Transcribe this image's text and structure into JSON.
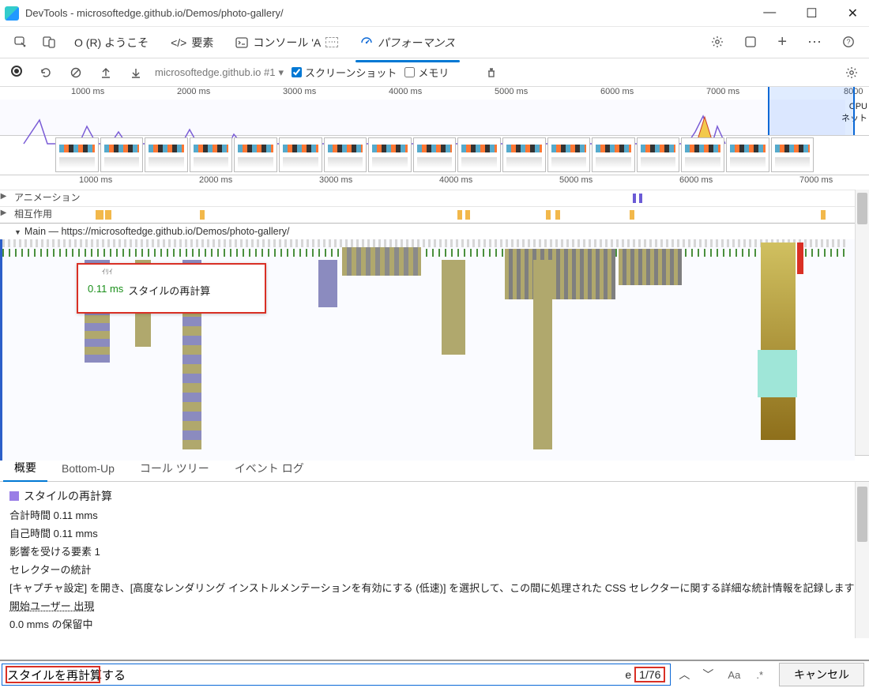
{
  "window": {
    "title": "DevTools - microsoftedge.github.io/Demos/photo-gallery/"
  },
  "tabs": {
    "welcome": "O (R) ようこそ",
    "elements": "要素",
    "console": "コンソール 'A",
    "performance": "パフォーマンス"
  },
  "toolbar": {
    "target": "microsoftedge.github.io #1",
    "screenshots_label": "スクリーンショット",
    "memory_label": "メモリ"
  },
  "overview": {
    "ticks": [
      "1000 ms",
      "2000 ms",
      "3000 ms",
      "4000 ms",
      "5000 ms",
      "6000 ms",
      "7000 ms",
      "8000"
    ],
    "labels": {
      "cpu": "CPU",
      "net": "ネット"
    }
  },
  "ruler2": [
    "1000 ms",
    "2000 ms",
    "3000 ms",
    "4000 ms",
    "5000 ms",
    "6000 ms",
    "7000 ms"
  ],
  "lanes": {
    "animation": "アニメーション",
    "interaction": "相互作用",
    "main_title": "Main — https://microsoftedge.github.io/Demos/photo-gallery/"
  },
  "tooltip": {
    "ms": "0.11 ms",
    "label": "スタイルの再計算"
  },
  "bottom_tabs": {
    "summary": "概要",
    "bottom_up": "Bottom-Up",
    "call_tree": "コール ツリー",
    "event_log": "イベント ログ"
  },
  "summary": {
    "title": "スタイルの再計算",
    "total_time": "合計時間 0.11 mms",
    "self_time": "自己時間 0.11 mms",
    "affected": "影響を受ける要素  1",
    "selector": "セレクターの統計",
    "hint": "[キャプチャ設定] を開き、[高度なレンダリング インストルメンテーションを有効にする (低速)] を選択して、この間に処理された CSS セレクターに関する詳細な統計情報を記録します",
    "initiator": "開始ユーザー   出現",
    "pending": "0.0 mms の保留中"
  },
  "search": {
    "value": "スタイルを再計算する",
    "count_prefix": "e ",
    "count": "1/76",
    "cancel": "キャンセル",
    "case": "Aa",
    "regex": ".*"
  },
  "chart_data": {
    "type": "flame-chart",
    "title": "Performance main-thread flame chart",
    "x_range_ms": [
      0,
      8000
    ],
    "tracks": [
      "アニメーション",
      "相互作用",
      "Main"
    ],
    "selected_event": {
      "name": "スタイルの再計算",
      "self_ms": 0.11,
      "total_ms": 0.11
    },
    "overview_cpu_peaks_ms": [
      490,
      870,
      1030,
      1730,
      2160,
      6750,
      6810
    ],
    "interaction_events_ms": [
      840,
      860,
      1720,
      1740,
      4080,
      4100,
      4860,
      4880,
      5700,
      7560
    ]
  }
}
